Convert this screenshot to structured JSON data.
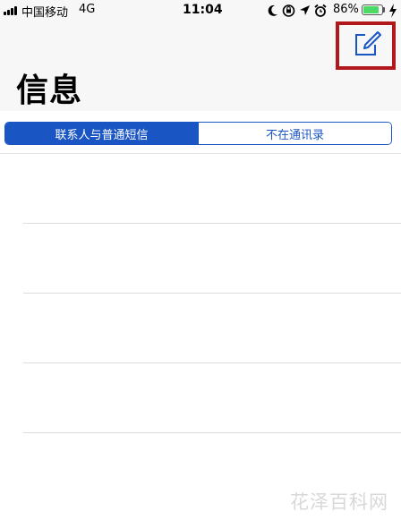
{
  "status_bar": {
    "carrier": "中国移动",
    "network": "4G",
    "time": "11:04",
    "battery_percent": "86%",
    "battery_level": 0.86,
    "icons": [
      "signal-bars-icon",
      "do-not-disturb-moon-icon",
      "rotation-lock-icon",
      "location-arrow-icon",
      "alarm-clock-icon",
      "battery-icon",
      "charging-bolt-icon"
    ]
  },
  "nav": {
    "title": "信息",
    "compose_icon": "compose-icon",
    "highlight_color": "#b0181c"
  },
  "segmented": {
    "tabs": [
      {
        "label": "联系人与普通短信",
        "selected": true
      },
      {
        "label": "不在通讯录",
        "selected": false
      }
    ],
    "accent_color": "#1a55c4"
  },
  "list": {
    "rows": [
      "",
      "",
      "",
      "",
      ""
    ]
  },
  "watermark": "花泽百科网"
}
